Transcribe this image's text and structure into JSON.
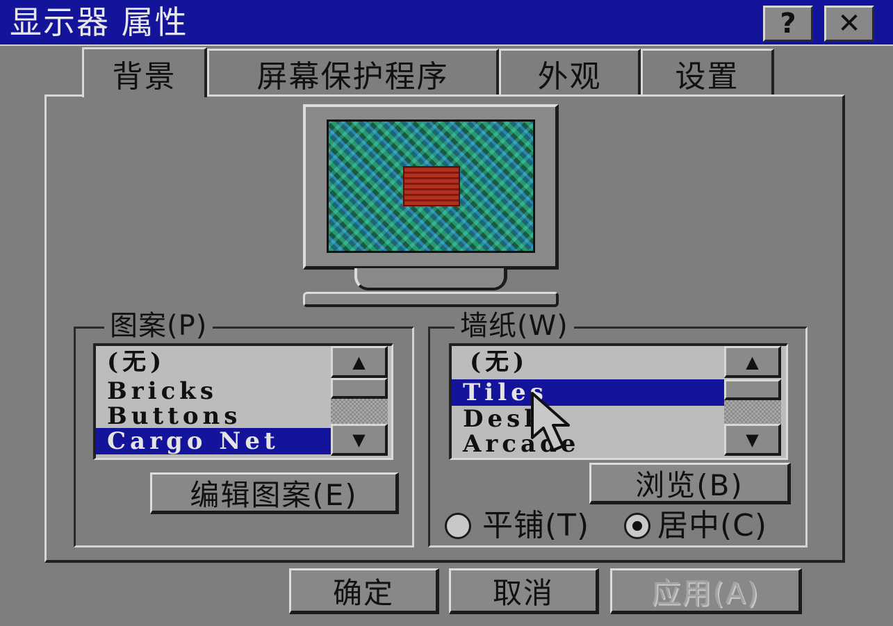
{
  "window": {
    "title": "显示器 属性",
    "help_button": "?",
    "close_button": "✕"
  },
  "tabs": [
    {
      "label": "背景",
      "active": true
    },
    {
      "label": "屏幕保护程序",
      "active": false
    },
    {
      "label": "外观",
      "active": false
    },
    {
      "label": "设置",
      "active": false
    }
  ],
  "pattern": {
    "group_label": "图案(P)",
    "items": [
      "(无)",
      "Bricks",
      "Buttons",
      "Cargo Net"
    ],
    "selected": "Cargo Net",
    "edit_button": "编辑图案(E)"
  },
  "wallpaper": {
    "group_label": "墙纸(W)",
    "items": [
      "(无)",
      "Tiles",
      "Desk",
      "Arcade"
    ],
    "selected": "Tiles",
    "browse_button": "浏览(B)",
    "radio_tile": "平铺(T)",
    "radio_center": "居中(C)",
    "display_mode": "center"
  },
  "footer": {
    "ok": "确定",
    "cancel": "取消",
    "apply": "应用(A)"
  },
  "icons": {
    "scroll_up": "▲",
    "scroll_down": "▼"
  },
  "colors": {
    "titlebar": "#14149a",
    "selection": "#14149a",
    "face": "#7e7e7e"
  }
}
